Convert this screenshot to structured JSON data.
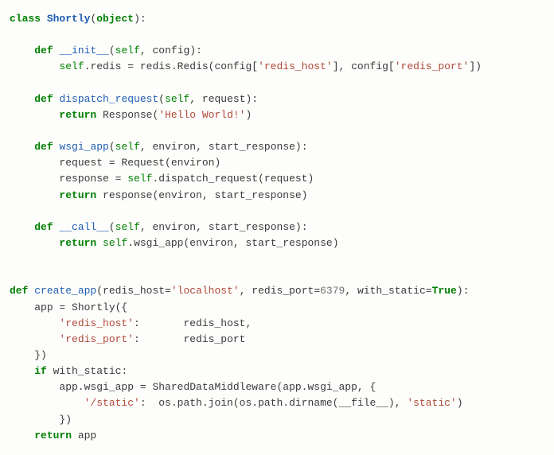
{
  "code": {
    "line1": {
      "kw_class": "class",
      "cls": "Shortly",
      "open": "(",
      "obj": "object",
      "close": "):"
    },
    "line2": "",
    "line3": {
      "pad": "    ",
      "kw_def": "def",
      "sp": " ",
      "func": "__init__",
      "open": "(",
      "self": "self",
      "rest": ", config):"
    },
    "line4": {
      "pad": "        ",
      "self": "self",
      "a": ".redis = redis.Redis(config[",
      "s1": "'redis_host'",
      "b": "], config[",
      "s2": "'redis_port'",
      "c": "])"
    },
    "line5": "",
    "line6": {
      "pad": "    ",
      "kw_def": "def",
      "sp": " ",
      "func": "dispatch_request",
      "open": "(",
      "self": "self",
      "rest": ", request):"
    },
    "line7": {
      "pad": "        ",
      "kw_ret": "return",
      "a": " Response(",
      "s1": "'Hello World!'",
      "b": ")"
    },
    "line8": "",
    "line9": {
      "pad": "    ",
      "kw_def": "def",
      "sp": " ",
      "func": "wsgi_app",
      "open": "(",
      "self": "self",
      "rest": ", environ, start_response):"
    },
    "line10": {
      "pad": "        ",
      "a": "request = Request(environ)"
    },
    "line11": {
      "pad": "        ",
      "a": "response = ",
      "self": "self",
      "b": ".dispatch_request(request)"
    },
    "line12": {
      "pad": "        ",
      "kw_ret": "return",
      "a": " response(environ, start_response)"
    },
    "line13": "",
    "line14": {
      "pad": "    ",
      "kw_def": "def",
      "sp": " ",
      "func": "__call__",
      "open": "(",
      "self": "self",
      "rest": ", environ, start_response):"
    },
    "line15": {
      "pad": "        ",
      "kw_ret": "return",
      "a": " ",
      "self": "self",
      "b": ".wsgi_app(environ, start_response)"
    },
    "line16": "",
    "line17": "",
    "line18": {
      "kw_def": "def",
      "sp": " ",
      "func": "create_app",
      "open": "(",
      "a": "redis_host=",
      "s1": "'localhost'",
      "b": ", redis_port=",
      "num": "6379",
      "c": ", with_static=",
      "bool": "True",
      "d": "):"
    },
    "line19": {
      "pad": "    ",
      "a": "app = Shortly({"
    },
    "line20": {
      "pad": "        ",
      "s1": "'redis_host'",
      "a": ":       redis_host,"
    },
    "line21": {
      "pad": "        ",
      "s1": "'redis_port'",
      "a": ":       redis_port"
    },
    "line22": {
      "pad": "    ",
      "a": "})"
    },
    "line23": {
      "pad": "    ",
      "kw_if": "if",
      "a": " with_static:"
    },
    "line24": {
      "pad": "        ",
      "a": "app.wsgi_app = SharedDataMiddleware(app.wsgi_app, {"
    },
    "line25": {
      "pad": "            ",
      "s1": "'/static'",
      "a": ":  os.path.join(os.path.dirname(__file__), ",
      "s2": "'static'",
      "b": ")"
    },
    "line26": {
      "pad": "        ",
      "a": "})"
    },
    "line27": {
      "pad": "    ",
      "kw_ret": "return",
      "a": " app"
    }
  }
}
